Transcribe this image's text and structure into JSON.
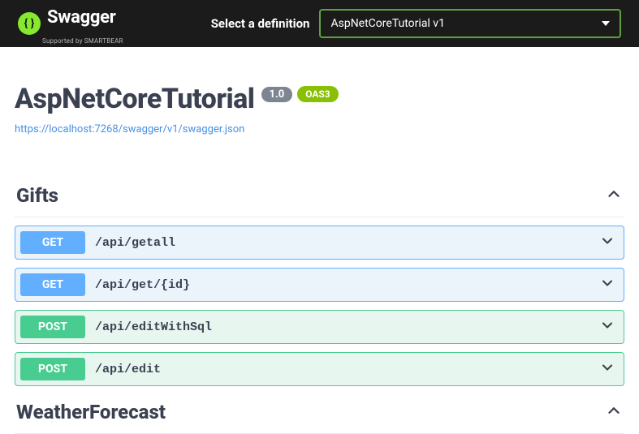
{
  "topbar": {
    "brand_name": "Swagger",
    "brand_sub": "Supported by SMARTBEAR",
    "definition_label": "Select a definition",
    "definition_value": "AspNetCoreTutorial v1"
  },
  "info": {
    "title": "AspNetCoreTutorial",
    "version": "1.0",
    "oas": "OAS3",
    "spec_url": "https://localhost:7268/swagger/v1/swagger.json"
  },
  "tags": [
    {
      "name": "Gifts",
      "expanded": true,
      "ops": [
        {
          "method": "GET",
          "path": "/api/getall"
        },
        {
          "method": "GET",
          "path": "/api/get/{id}"
        },
        {
          "method": "POST",
          "path": "/api/editWithSql"
        },
        {
          "method": "POST",
          "path": "/api/edit"
        }
      ]
    },
    {
      "name": "WeatherForecast",
      "expanded": true,
      "ops": []
    }
  ]
}
